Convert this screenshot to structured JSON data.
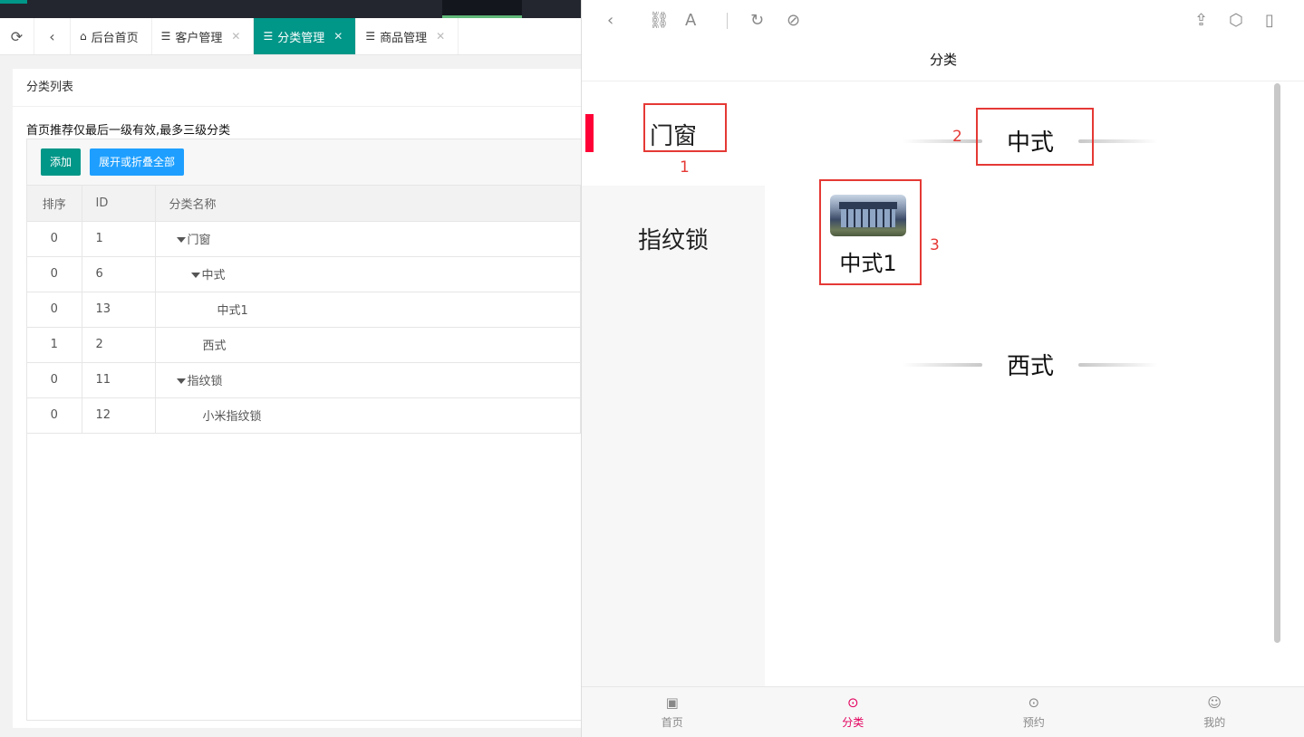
{
  "admin": {
    "tabs": [
      {
        "label": "后台首页",
        "icon": "home-icon",
        "closable": false
      },
      {
        "label": "客户管理",
        "icon": "list-icon",
        "closable": true
      },
      {
        "label": "分类管理",
        "icon": "list-icon",
        "closable": true,
        "active": true
      },
      {
        "label": "商品管理",
        "icon": "list-icon",
        "closable": true
      }
    ],
    "card_title": "分类列表",
    "notice": "首页推荐仅最后一级有效,最多三级分类",
    "buttons": {
      "add": "添加",
      "toggle": "展开或折叠全部"
    },
    "columns": [
      "排序",
      "ID",
      "分类名称"
    ],
    "rows": [
      {
        "sort": "0",
        "id": "1",
        "name": "门窗",
        "level": 1,
        "expandable": true
      },
      {
        "sort": "0",
        "id": "6",
        "name": "中式",
        "level": 2,
        "expandable": true
      },
      {
        "sort": "0",
        "id": "13",
        "name": "中式1",
        "level": 3,
        "expandable": false
      },
      {
        "sort": "1",
        "id": "2",
        "name": "西式",
        "level": 2,
        "expandable": false
      },
      {
        "sort": "0",
        "id": "11",
        "name": "指纹锁",
        "level": 1,
        "expandable": true
      },
      {
        "sort": "0",
        "id": "12",
        "name": "小米指纹锁",
        "level": 2,
        "expandable": false
      }
    ],
    "colors": {
      "primary": "#009688",
      "blue": "#1e9fff",
      "topbar": "#23262e"
    }
  },
  "mobile": {
    "page_title": "分类",
    "left_categories": [
      {
        "label": "门窗",
        "selected": true
      },
      {
        "label": "指纹锁",
        "selected": false
      }
    ],
    "sections": [
      {
        "title": "中式",
        "products": [
          {
            "name": "中式1"
          }
        ]
      },
      {
        "title": "西式",
        "products": []
      }
    ],
    "annotations": [
      "1",
      "2",
      "3"
    ],
    "bottom_nav": [
      {
        "label": "首页",
        "icon": "bag-icon"
      },
      {
        "label": "分类",
        "icon": "compass-icon",
        "active": true
      },
      {
        "label": "预约",
        "icon": "compass-icon"
      },
      {
        "label": "我的",
        "icon": "user-icon"
      }
    ],
    "colors": {
      "accent": "#e3005e",
      "selected_bar": "#ff0036",
      "annotation": "#e53935"
    }
  }
}
